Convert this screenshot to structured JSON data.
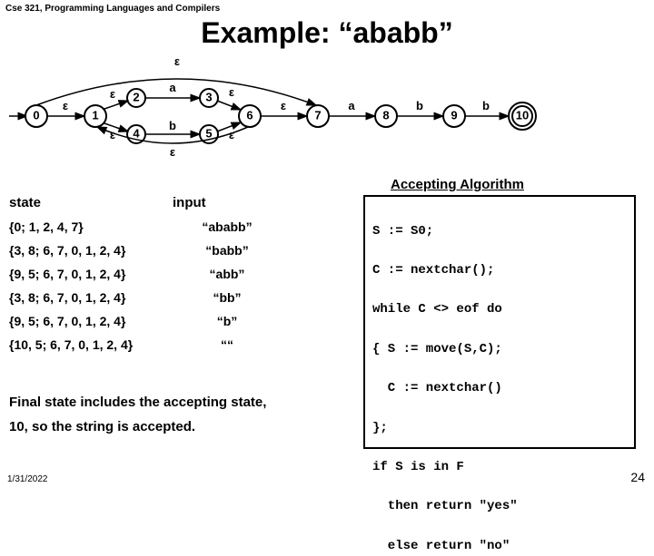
{
  "course": "Cse 321, Programming Languages and Compilers",
  "title": "Example:  “ababb”",
  "date": "1/31/2022",
  "page": "24",
  "nfa": {
    "eps": "ε",
    "a": "a",
    "b": "b",
    "nodes": [
      "0",
      "1",
      "2",
      "3",
      "4",
      "5",
      "6",
      "7",
      "8",
      "9",
      "10"
    ]
  },
  "table": {
    "header": {
      "state": "state",
      "input": "input"
    },
    "rows": [
      {
        "state": "{0; 1, 2, 4, 7}",
        "input": "“ababb”"
      },
      {
        "state": "{3, 8; 6, 7, 0, 1, 2, 4}",
        "input": "“babb”"
      },
      {
        "state": "{9, 5; 6, 7, 0, 1, 2, 4}",
        "input": "“abb”"
      },
      {
        "state": "{3, 8; 6, 7, 0, 1, 2, 4}",
        "input": "“bb”"
      },
      {
        "state": "{9, 5; 6, 7, 0, 1, 2, 4}",
        "input": "“b”"
      },
      {
        "state": "{10, 5; 6, 7, 0, 1, 2, 4}",
        "input": "““"
      }
    ]
  },
  "algorithm": {
    "title": "Accepting Algorithm",
    "lines": [
      "S := S0;",
      "C := nextchar();",
      "while C <> eof do",
      "{ S := move(S,C);",
      "  C := nextchar()",
      "};",
      "if S is in F",
      "  then return \"yes\"",
      "  else return \"no\""
    ]
  },
  "conclusion": {
    "l1": "Final state includes the accepting state,",
    "l2": "10,   so the string is accepted."
  }
}
